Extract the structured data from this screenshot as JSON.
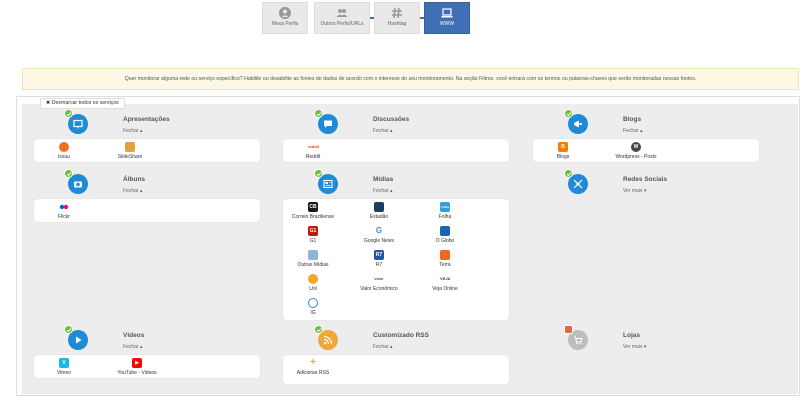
{
  "wizard": {
    "steps": [
      {
        "label": "Meus Perfis",
        "icon": "user-icon"
      },
      {
        "label": "Outros Perfis/URLs",
        "icon": "users-icon"
      },
      {
        "label": "Hashtag",
        "icon": "hashtag-icon"
      },
      {
        "label": "WWW",
        "icon": "laptop-icon"
      }
    ],
    "active_step": 4,
    "accent": "#3f6fb5"
  },
  "notice": "Quer monitorar alguma rede ou serviço específico? Habilite ou desabilite as fontes de dados de acordo com o interesse do seu monitoramento. Na seção Filtros, você entrará com os termos ou palavras-chaves que serão monitoradas nessas fontes.",
  "uncheck_all": "✖ Desmarcar todos os serviços",
  "categories": {
    "apresentacoes": {
      "title": "Apresentações",
      "toggle": "Fechar ▴",
      "items": [
        "Issuu",
        "SlideShare"
      ]
    },
    "discussoes": {
      "title": "Discussões",
      "toggle": "Fechar ▴",
      "items": [
        "Reddit"
      ]
    },
    "blogs": {
      "title": "Blogs",
      "toggle": "Fechar ▴",
      "items": [
        "Blogs",
        "Wordpress - Posts"
      ]
    },
    "albuns": {
      "title": "Álbuns",
      "toggle": "Fechar ▴",
      "items": [
        "Flickr"
      ]
    },
    "midias": {
      "title": "Mídias",
      "toggle": "Fechar ▴",
      "items": [
        "Correio Braziliense",
        "Estadão",
        "Folha",
        "G1",
        "Google News",
        "O Globo",
        "Outras Mídias",
        "R7",
        "Terra",
        "Uol",
        "Valor Econômico",
        "Veja Online",
        "IG"
      ]
    },
    "redes": {
      "title": "Redes Sociais",
      "toggle": "Ver mais ▾"
    },
    "videos": {
      "title": "Vídeos",
      "toggle": "Fechar ▴",
      "items": [
        "Vimeo",
        "YouTube - Videos"
      ]
    },
    "rss": {
      "title": "Customizado RSS",
      "toggle": "Fechar ▴",
      "items": [
        "Adicionar RSS"
      ]
    },
    "lojas": {
      "title": "Lojas",
      "toggle": "Ver mais ▾"
    }
  }
}
